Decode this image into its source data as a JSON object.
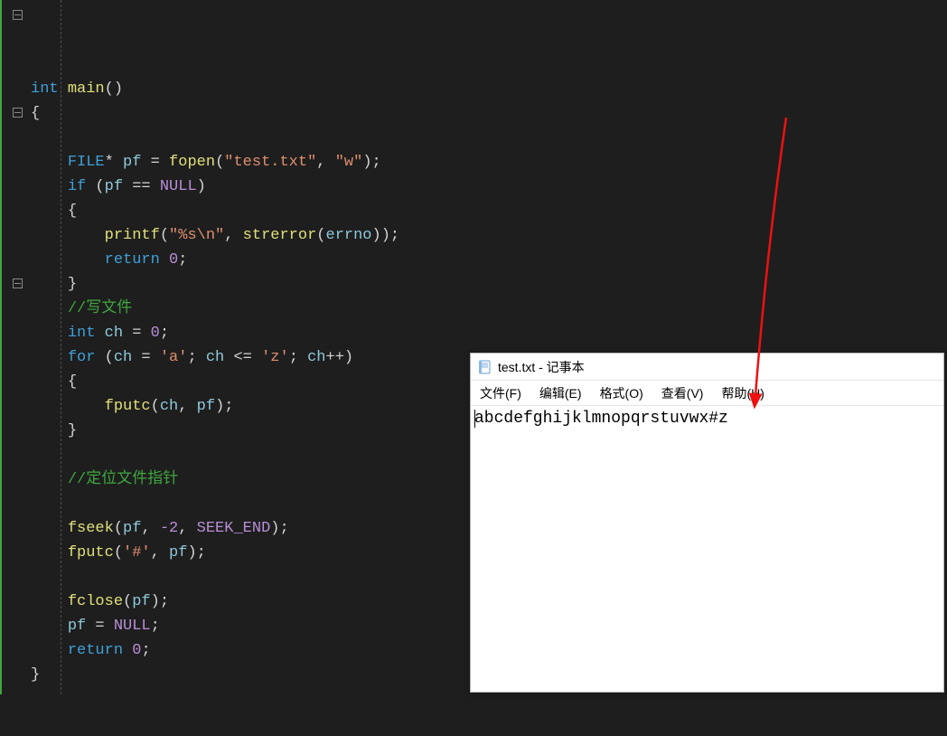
{
  "code": {
    "lines": [
      {
        "fold": true,
        "indent": 0,
        "tokens": [
          [
            "kw",
            "int"
          ],
          [
            "op",
            " "
          ],
          [
            "fn",
            "main"
          ],
          [
            "br",
            "()"
          ]
        ]
      },
      {
        "fold": false,
        "indent": 0,
        "tokens": [
          [
            "br",
            "{"
          ]
        ]
      },
      {
        "fold": false,
        "indent": 1,
        "tokens": []
      },
      {
        "fold": false,
        "indent": 1,
        "tokens": [
          [
            "type",
            "FILE"
          ],
          [
            "op",
            "* "
          ],
          [
            "var",
            "pf"
          ],
          [
            "op",
            " = "
          ],
          [
            "fn",
            "fopen"
          ],
          [
            "br",
            "("
          ],
          [
            "str",
            "\"test.txt\""
          ],
          [
            "op",
            ", "
          ],
          [
            "str",
            "\"w\""
          ],
          [
            "br",
            ")"
          ],
          [
            "op",
            ";"
          ]
        ]
      },
      {
        "fold": true,
        "indent": 1,
        "tokens": [
          [
            "kw",
            "if"
          ],
          [
            "op",
            " "
          ],
          [
            "br",
            "("
          ],
          [
            "var",
            "pf"
          ],
          [
            "op",
            " == "
          ],
          [
            "mac",
            "NULL"
          ],
          [
            "br",
            ")"
          ]
        ]
      },
      {
        "fold": false,
        "indent": 1,
        "tokens": [
          [
            "br",
            "{"
          ]
        ]
      },
      {
        "fold": false,
        "indent": 2,
        "tokens": [
          [
            "fn",
            "printf"
          ],
          [
            "br",
            "("
          ],
          [
            "str",
            "\"%s\\n\""
          ],
          [
            "op",
            ", "
          ],
          [
            "fn",
            "strerror"
          ],
          [
            "br",
            "("
          ],
          [
            "var",
            "errno"
          ],
          [
            "br",
            "))"
          ],
          [
            "op",
            ";"
          ]
        ]
      },
      {
        "fold": false,
        "indent": 2,
        "tokens": [
          [
            "kw",
            "return"
          ],
          [
            "op",
            " "
          ],
          [
            "mac",
            "0"
          ],
          [
            "op",
            ";"
          ]
        ]
      },
      {
        "fold": false,
        "indent": 1,
        "tokens": [
          [
            "br",
            "}"
          ]
        ]
      },
      {
        "fold": false,
        "indent": 1,
        "tokens": [
          [
            "cmt",
            "//写文件"
          ]
        ]
      },
      {
        "fold": false,
        "indent": 1,
        "tokens": [
          [
            "kw",
            "int"
          ],
          [
            "op",
            " "
          ],
          [
            "var",
            "ch"
          ],
          [
            "op",
            " = "
          ],
          [
            "mac",
            "0"
          ],
          [
            "op",
            ";"
          ]
        ]
      },
      {
        "fold": true,
        "indent": 1,
        "tokens": [
          [
            "kw",
            "for"
          ],
          [
            "op",
            " "
          ],
          [
            "br",
            "("
          ],
          [
            "var",
            "ch"
          ],
          [
            "op",
            " = "
          ],
          [
            "str",
            "'a'"
          ],
          [
            "op",
            "; "
          ],
          [
            "var",
            "ch"
          ],
          [
            "op",
            " <= "
          ],
          [
            "str",
            "'z'"
          ],
          [
            "op",
            "; "
          ],
          [
            "var",
            "ch"
          ],
          [
            "op",
            "++"
          ],
          [
            "br",
            ")"
          ]
        ]
      },
      {
        "fold": false,
        "indent": 1,
        "tokens": [
          [
            "br",
            "{"
          ]
        ]
      },
      {
        "fold": false,
        "indent": 2,
        "tokens": [
          [
            "fn",
            "fputc"
          ],
          [
            "br",
            "("
          ],
          [
            "var",
            "ch"
          ],
          [
            "op",
            ", "
          ],
          [
            "var",
            "pf"
          ],
          [
            "br",
            ")"
          ],
          [
            "op",
            ";"
          ]
        ]
      },
      {
        "fold": false,
        "indent": 1,
        "tokens": [
          [
            "br",
            "}"
          ]
        ]
      },
      {
        "fold": false,
        "indent": 1,
        "tokens": []
      },
      {
        "fold": false,
        "indent": 1,
        "tokens": [
          [
            "cmt",
            "//定位文件指针"
          ]
        ]
      },
      {
        "fold": false,
        "indent": 1,
        "tokens": []
      },
      {
        "fold": false,
        "indent": 1,
        "tokens": [
          [
            "fn",
            "fseek"
          ],
          [
            "br",
            "("
          ],
          [
            "var",
            "pf"
          ],
          [
            "op",
            ", "
          ],
          [
            "mac",
            "-2"
          ],
          [
            "op",
            ", "
          ],
          [
            "mac",
            "SEEK_END"
          ],
          [
            "br",
            ")"
          ],
          [
            "op",
            ";"
          ]
        ]
      },
      {
        "fold": false,
        "indent": 1,
        "tokens": [
          [
            "fn",
            "fputc"
          ],
          [
            "br",
            "("
          ],
          [
            "str",
            "'#'"
          ],
          [
            "op",
            ", "
          ],
          [
            "var",
            "pf"
          ],
          [
            "br",
            ")"
          ],
          [
            "op",
            ";"
          ]
        ]
      },
      {
        "fold": false,
        "indent": 1,
        "tokens": []
      },
      {
        "fold": false,
        "indent": 1,
        "tokens": [
          [
            "fn",
            "fclose"
          ],
          [
            "br",
            "("
          ],
          [
            "var",
            "pf"
          ],
          [
            "br",
            ")"
          ],
          [
            "op",
            ";"
          ]
        ]
      },
      {
        "fold": false,
        "indent": 1,
        "tokens": [
          [
            "var",
            "pf"
          ],
          [
            "op",
            " = "
          ],
          [
            "mac",
            "NULL"
          ],
          [
            "op",
            ";"
          ]
        ]
      },
      {
        "fold": false,
        "indent": 1,
        "tokens": [
          [
            "kw",
            "return"
          ],
          [
            "op",
            " "
          ],
          [
            "mac",
            "0"
          ],
          [
            "op",
            ";"
          ]
        ]
      },
      {
        "fold": false,
        "indent": 0,
        "tokens": [
          [
            "br",
            "}"
          ]
        ]
      }
    ],
    "indent_unit": "    "
  },
  "notepad": {
    "title": "test.txt - 记事本",
    "menus": {
      "file": "文件(F)",
      "edit": "编辑(E)",
      "format": "格式(O)",
      "view": "查看(V)",
      "help": "帮助(H)"
    },
    "content": "abcdefghijklmnopqrstuvwx#z"
  },
  "arrow": {
    "color": "#e11"
  }
}
